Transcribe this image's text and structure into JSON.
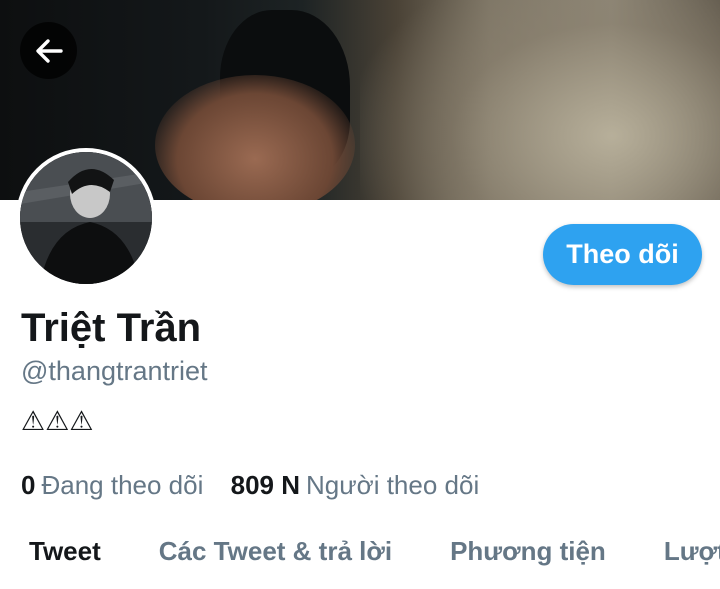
{
  "header": {
    "back_icon": "arrow-left-icon"
  },
  "profile": {
    "display_name": "Triệt Trần",
    "handle": "@thangtrantriet",
    "bio": "⚠⚠⚠",
    "follow_label": "Theo dõi"
  },
  "stats": {
    "following_count": "0",
    "following_label": "Đang theo dõi",
    "followers_count": "809 N",
    "followers_label": "Người theo dõi"
  },
  "tabs": [
    {
      "label": "Tweet",
      "active": true
    },
    {
      "label": "Các Tweet & trả lời",
      "active": false
    },
    {
      "label": "Phương tiện",
      "active": false
    },
    {
      "label": "Lượt thích",
      "active": false
    }
  ],
  "colors": {
    "accent": "#2ea2f0",
    "text_primary": "#14171a",
    "text_secondary": "#657786"
  }
}
